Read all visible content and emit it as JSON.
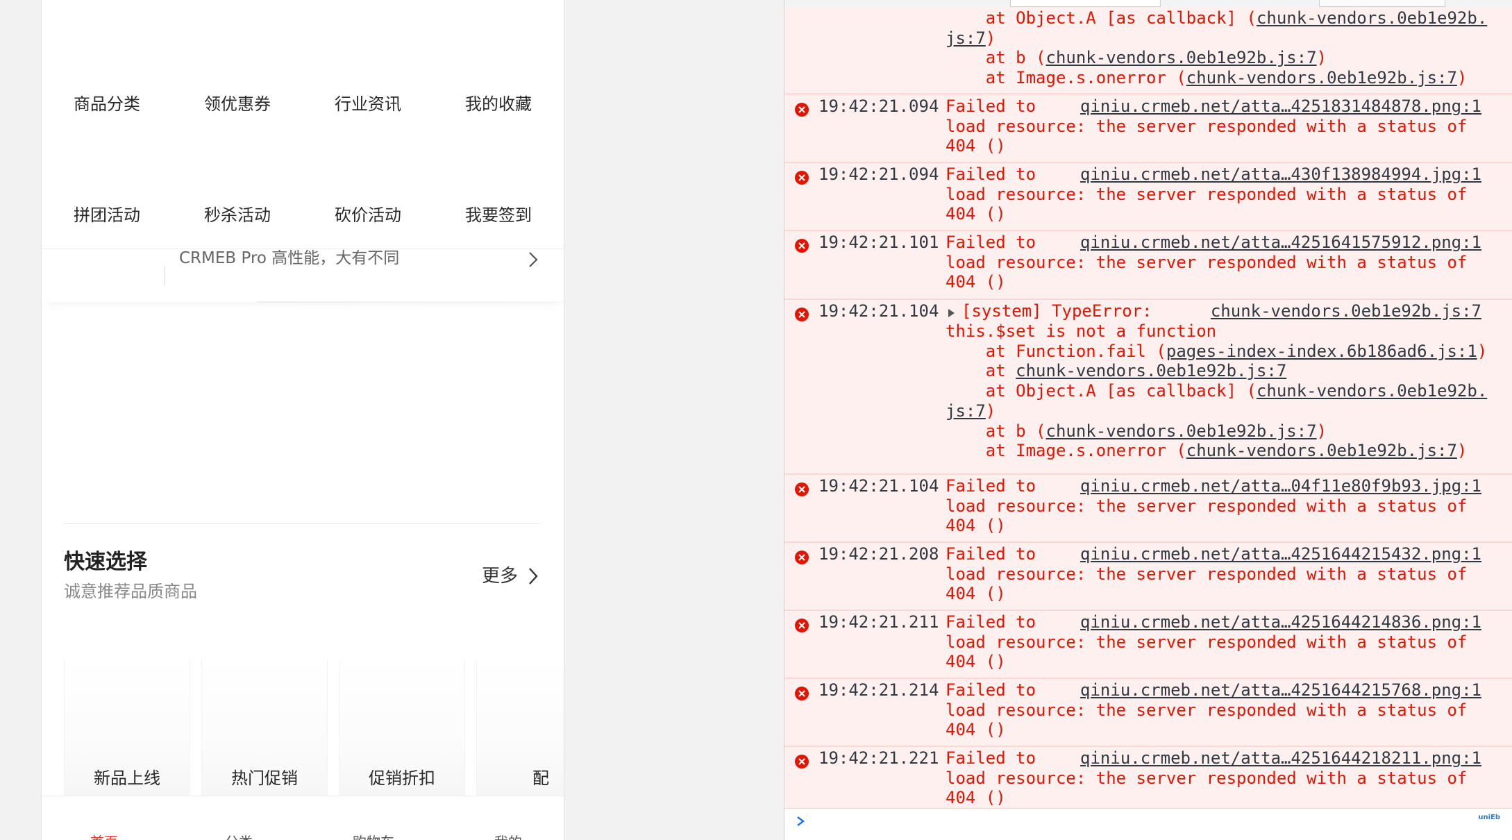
{
  "phone": {
    "grid_row1": [
      "商品分类",
      "领优惠券",
      "行业资讯",
      "我的收藏"
    ],
    "grid_row2": [
      "拼团活动",
      "秒杀活动",
      "砍价活动",
      "我要签到"
    ],
    "news_text": "CRMEB Pro 高性能，大有不同",
    "section_title": "快速选择",
    "section_subtitle": "诚意推荐品质商品",
    "more_label": "更多",
    "quick_items": [
      "新品上线",
      "热门促销",
      "促销折扣",
      "配"
    ],
    "tabs": [
      {
        "label": "首页",
        "active": true
      },
      {
        "label": "分类",
        "active": false
      },
      {
        "label": "购物车",
        "active": false
      },
      {
        "label": "我的",
        "active": false
      }
    ],
    "accent_color": "#e93323"
  },
  "console": {
    "top_trace": {
      "lines": [
        {
          "text": "    at Object.A [as callback] (",
          "link": "chunk-vendors.0eb1e92b.",
          "after": ""
        },
        {
          "text": "",
          "link": "js:7",
          "after": ")"
        },
        {
          "text": "    at b (",
          "link": "chunk-vendors.0eb1e92b.js:7",
          "after": ")"
        },
        {
          "text": "    at Image.s.onerror (",
          "link": "chunk-vendors.0eb1e92b.js:7",
          "after": ")"
        }
      ]
    },
    "messages": [
      {
        "time": "19:42:21.094",
        "source": "qiniu.crmeb.net/atta…4251831484878.png:1",
        "line1": "Failed to",
        "line2": "load resource: the server responded with a status of",
        "line3": "404 ()"
      },
      {
        "time": "19:42:21.094",
        "source": "qiniu.crmeb.net/atta…430f138984994.jpg:1",
        "line1": "Failed to",
        "line2": "load resource: the server responded with a status of",
        "line3": "404 ()"
      },
      {
        "time": "19:42:21.101",
        "source": "qiniu.crmeb.net/atta…4251641575912.png:1",
        "line1": "Failed to",
        "line2": "load resource: the server responded with a status of",
        "line3": "404 ()"
      }
    ],
    "type_error": {
      "time": "19:42:21.104",
      "source": "chunk-vendors.0eb1e92b.js:7",
      "line1": "[system] TypeError:",
      "line2": "this.$set is not a function",
      "trace": [
        {
          "text": "    at Function.fail (",
          "link": "pages-index-index.6b186ad6.js:1",
          "after": ")"
        },
        {
          "text": "    at ",
          "link": "chunk-vendors.0eb1e92b.js:7",
          "after": ""
        },
        {
          "text": "    at Object.A [as callback] (",
          "link": "chunk-vendors.0eb1e92b.",
          "after": ""
        },
        {
          "text": "",
          "link": "js:7",
          "after": ")"
        },
        {
          "text": "    at b (",
          "link": "chunk-vendors.0eb1e92b.js:7",
          "after": ")"
        },
        {
          "text": "    at Image.s.onerror (",
          "link": "chunk-vendors.0eb1e92b.js:7",
          "after": ")"
        }
      ]
    },
    "messages2": [
      {
        "time": "19:42:21.104",
        "source": "qiniu.crmeb.net/atta…04f11e80f9b93.jpg:1",
        "line1": "Failed to",
        "line2": "load resource: the server responded with a status of",
        "line3": "404 ()"
      },
      {
        "time": "19:42:21.208",
        "source": "qiniu.crmeb.net/atta…4251644215432.png:1",
        "line1": "Failed to",
        "line2": "load resource: the server responded with a status of",
        "line3": "404 ()"
      },
      {
        "time": "19:42:21.211",
        "source": "qiniu.crmeb.net/atta…4251644214836.png:1",
        "line1": "Failed to",
        "line2": "load resource: the server responded with a status of",
        "line3": "404 ()"
      },
      {
        "time": "19:42:21.214",
        "source": "qiniu.crmeb.net/atta…4251644215768.png:1",
        "line1": "Failed to",
        "line2": "load resource: the server responded with a status of",
        "line3": "404 ()"
      },
      {
        "time": "19:42:21.221",
        "source": "qiniu.crmeb.net/atta…4251644218211.png:1",
        "line1": "Failed to",
        "line2": "load resource: the server responded with a status of",
        "line3": "404 ()"
      }
    ],
    "corner_logo": "uniEb",
    "error_color": "#e51400"
  }
}
